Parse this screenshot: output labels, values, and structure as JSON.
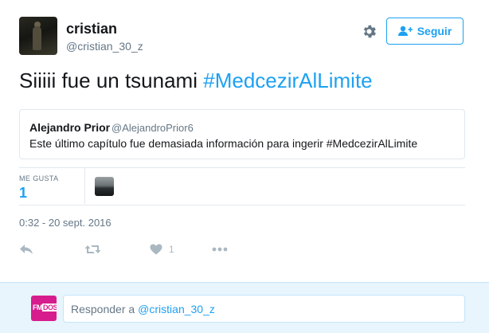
{
  "author": {
    "name": "cristian",
    "handle": "@cristian_30_z"
  },
  "follow_button": {
    "label": "Seguir"
  },
  "tweet": {
    "text": "Siiiii fue un tsunami",
    "hashtag": "#MedcezirAlLimite"
  },
  "quoted_tweet": {
    "name": "Alejandro Prior",
    "handle": "@AlejandroPrior6",
    "text": "Este último capítulo fue demasiada información para ingerir  #MedcezirAlLimite"
  },
  "stats": {
    "likes_label": "ME GUSTA",
    "likes_count": "1"
  },
  "timestamp": "0:32 - 20 sept. 2016",
  "actions": {
    "like_count": "1"
  },
  "reply": {
    "avatar_text": "FM",
    "avatar_text_highlight": "DOS",
    "placeholder": "Responder a",
    "mention": "@cristian_30_z"
  },
  "icons": {
    "settings": "gear-icon",
    "follow": "add-user-icon",
    "reply": "reply-icon",
    "retweet": "retweet-icon",
    "like": "heart-icon",
    "more": "more-icon"
  },
  "colors": {
    "accent": "#1da1f2",
    "muted": "#657786",
    "border": "#e1e8ed",
    "reply_bg": "#e8f5fd",
    "brand_pink": "#d71d8d"
  }
}
